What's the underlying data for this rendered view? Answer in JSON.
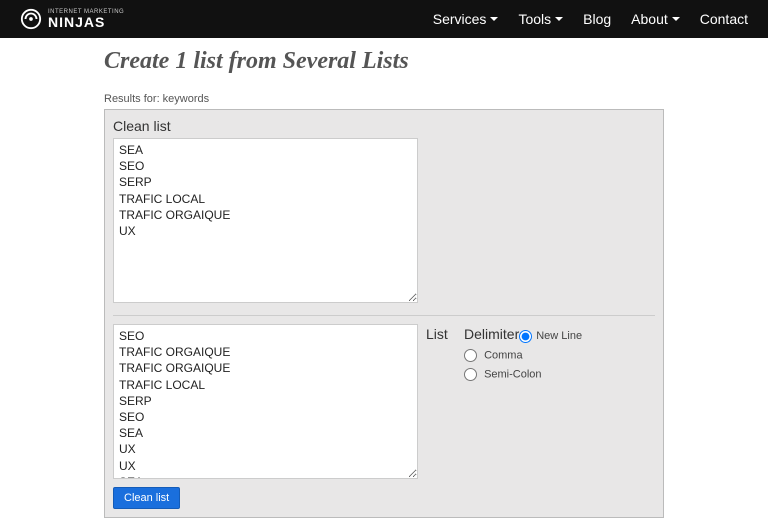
{
  "brand": {
    "top": "INTERNET MARKETING",
    "bottom": "NINJAS"
  },
  "nav": {
    "services": "Services",
    "tools": "Tools",
    "blog": "Blog",
    "about": "About",
    "contact": "Contact"
  },
  "page": {
    "title": "Create 1 list from Several Lists",
    "results_label": "Results for: keywords"
  },
  "clean_section": {
    "label": "Clean list",
    "output": "SEA\nSEO\nSERP\nTRAFIC LOCAL\nTRAFIC ORGAIQUE\nUX"
  },
  "input_section": {
    "list_label": "List",
    "list_value": "SEO\nTRAFIC ORGAIQUE\nTRAFIC ORGAIQUE\nTRAFIC LOCAL\nSERP\nSEO\nSEA\nUX\nUX\nSEA"
  },
  "delimiter": {
    "label": "Delimiter",
    "options": {
      "newline": "New Line",
      "comma": "Comma",
      "semicolon": "Semi-Colon"
    }
  },
  "buttons": {
    "clean": "Clean list"
  }
}
